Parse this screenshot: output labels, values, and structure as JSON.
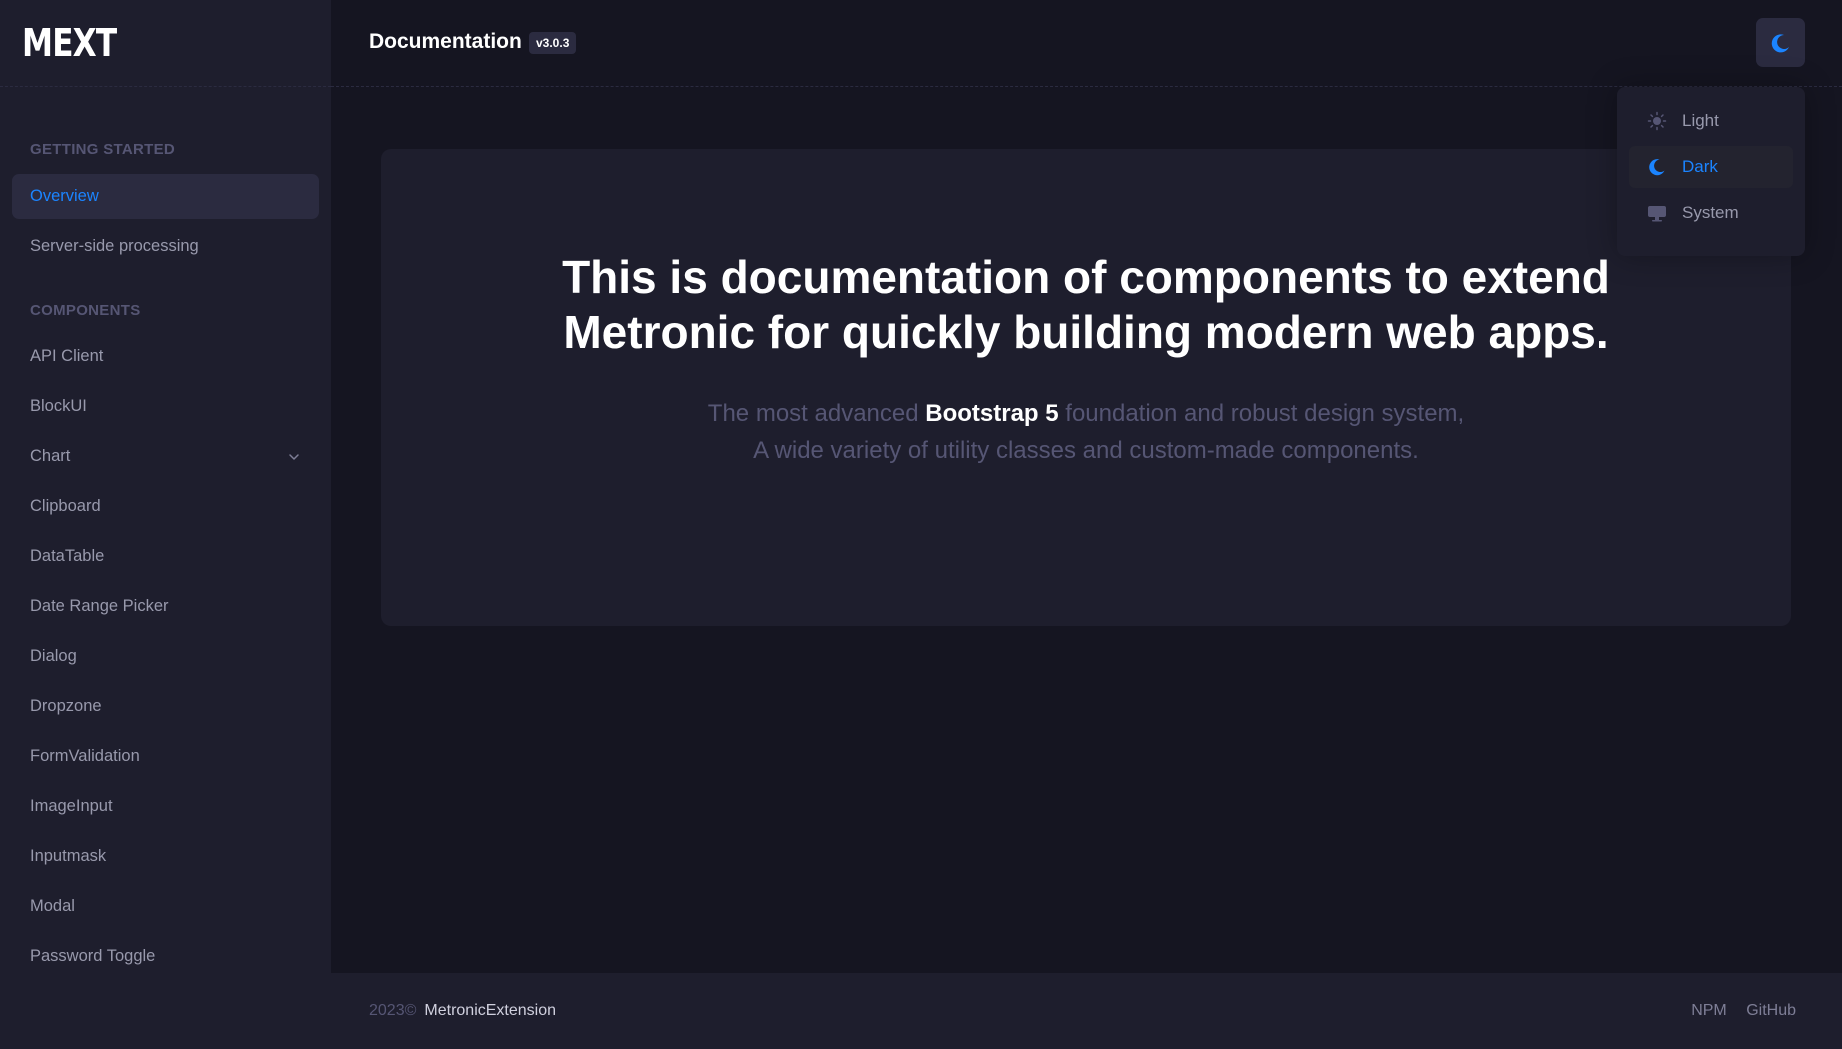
{
  "brand": {
    "logo": "MEXT"
  },
  "header": {
    "title": "Documentation",
    "version": "v3.0.3"
  },
  "theme_menu": {
    "items": [
      {
        "label": "Light",
        "icon": "sun-icon"
      },
      {
        "label": "Dark",
        "icon": "moon-icon",
        "active": true
      },
      {
        "label": "System",
        "icon": "monitor-icon"
      }
    ]
  },
  "sidebar": {
    "sections": [
      {
        "title": "GETTING STARTED",
        "items": [
          {
            "label": "Overview",
            "active": true
          },
          {
            "label": "Server-side processing"
          }
        ]
      },
      {
        "title": "COMPONENTS",
        "items": [
          {
            "label": "API Client"
          },
          {
            "label": "BlockUI"
          },
          {
            "label": "Chart",
            "has_submenu": true
          },
          {
            "label": "Clipboard"
          },
          {
            "label": "DataTable"
          },
          {
            "label": "Date Range Picker"
          },
          {
            "label": "Dialog"
          },
          {
            "label": "Dropzone"
          },
          {
            "label": "FormValidation"
          },
          {
            "label": "ImageInput"
          },
          {
            "label": "Inputmask"
          },
          {
            "label": "Modal"
          },
          {
            "label": "Password Toggle"
          }
        ]
      }
    ]
  },
  "hero": {
    "line1": "This is documentation of components to extend",
    "line2": "Metronic for quickly building modern web apps.",
    "sub_pre": "The most advanced ",
    "sub_strong": "Bootstrap 5",
    "sub_post": " foundation and robust design system,",
    "sub_line2": "A wide variety of utility classes and custom-made components."
  },
  "footer": {
    "copyright": "2023©",
    "company": "MetronicExtension",
    "links": [
      "NPM",
      "GitHub"
    ]
  },
  "colors": {
    "accent": "#1b84ff",
    "background": "#151521",
    "panel": "#1e1e2d"
  }
}
